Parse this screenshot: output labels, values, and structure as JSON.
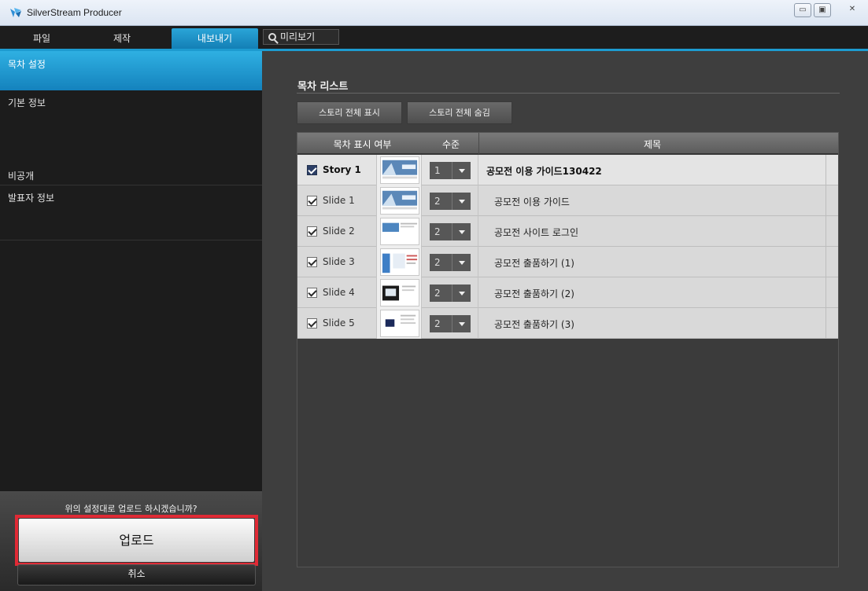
{
  "window": {
    "title": "SilverStream Producer",
    "controls": [
      "▭",
      "▣",
      "✕"
    ]
  },
  "menu": {
    "tabs": [
      {
        "label": "파일",
        "active": false
      },
      {
        "label": "제작",
        "active": false
      },
      {
        "label": "내보내기",
        "active": true
      }
    ],
    "preview_label": "미리보기"
  },
  "sidebar": {
    "items": [
      "목차 설정",
      "기본 정보",
      "비공개",
      "발표자 정보"
    ],
    "question": "위의 설정대로 업로드 하시겠습니까?",
    "upload_label": "업로드",
    "cancel_label": "취소"
  },
  "main": {
    "section_title": "목차 리스트",
    "show_all_label": "스토리 전체 표시",
    "hide_all_label": "스토리 전체 숨김",
    "columns": {
      "show": "목차 표시 여부",
      "level": "수준",
      "title": "제목"
    },
    "rows": [
      {
        "name": "Story 1",
        "checked": true,
        "level": "1",
        "title": "공모전 이용 가이드130422",
        "story": true
      },
      {
        "name": "Slide 1",
        "checked": true,
        "level": "2",
        "title": "공모전 이용 가이드",
        "story": false
      },
      {
        "name": "Slide 2",
        "checked": true,
        "level": "2",
        "title": "공모전 사이트 로그인",
        "story": false
      },
      {
        "name": "Slide 3",
        "checked": true,
        "level": "2",
        "title": "공모전 출품하기 (1)",
        "story": false
      },
      {
        "name": "Slide 4",
        "checked": true,
        "level": "2",
        "title": "공모전 출품하기 (2)",
        "story": false
      },
      {
        "name": "Slide 5",
        "checked": true,
        "level": "2",
        "title": "공모전 출품하기 (3)",
        "story": false
      }
    ]
  },
  "colors": {
    "accent": "#1d9bd0",
    "highlight": "#e02a35"
  }
}
